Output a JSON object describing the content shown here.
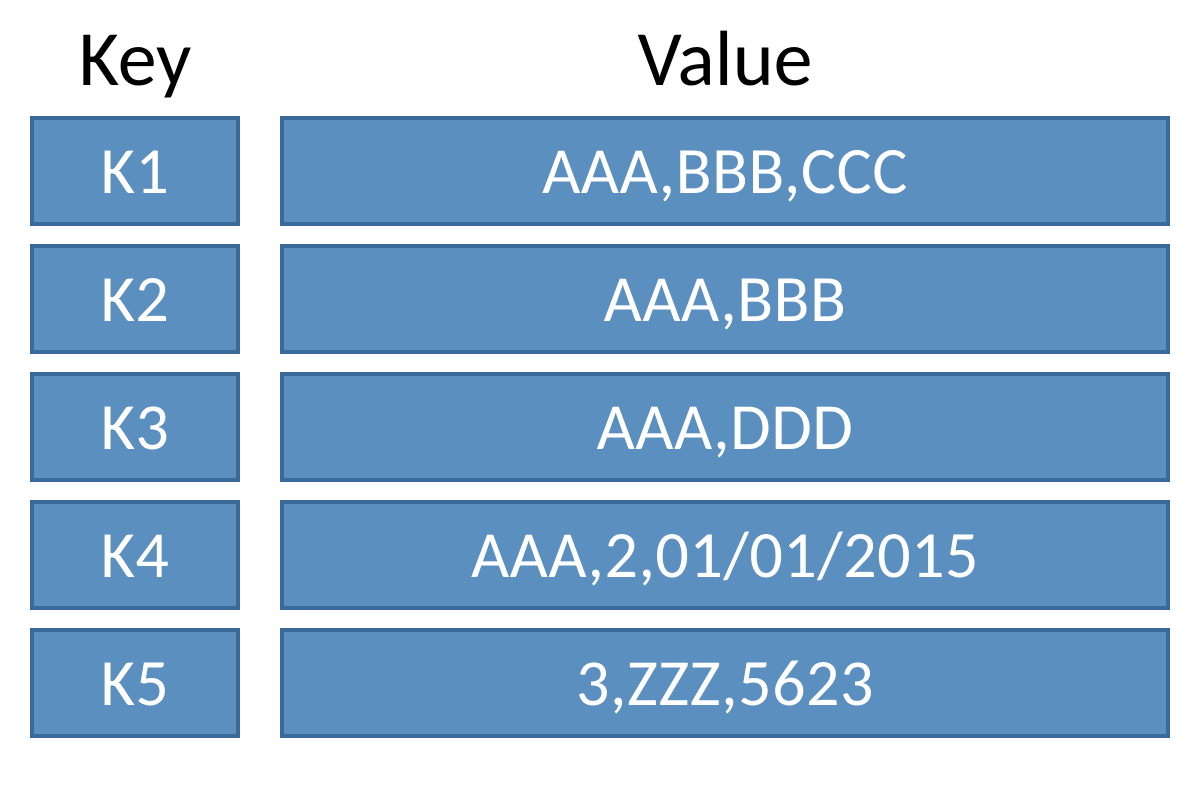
{
  "headers": {
    "key": "Key",
    "value": "Value"
  },
  "rows": [
    {
      "key": "K1",
      "value": "AAA,BBB,CCC"
    },
    {
      "key": "K2",
      "value": "AAA,BBB"
    },
    {
      "key": "K3",
      "value": "AAA,DDD"
    },
    {
      "key": "K4",
      "value": "AAA,2,01/01/2015"
    },
    {
      "key": "K5",
      "value": "3,ZZZ,5623"
    }
  ],
  "colors": {
    "cell_fill": "#5b8fbf",
    "cell_border": "#3a6a9a",
    "cell_text": "#ffffff",
    "header_text": "#000000"
  },
  "chart_data": {
    "type": "table",
    "title": "",
    "columns": [
      "Key",
      "Value"
    ],
    "rows": [
      [
        "K1",
        "AAA,BBB,CCC"
      ],
      [
        "K2",
        "AAA,BBB"
      ],
      [
        "K3",
        "AAA,DDD"
      ],
      [
        "K4",
        "AAA,2,01/01/2015"
      ],
      [
        "K5",
        "3,ZZZ,5623"
      ]
    ]
  }
}
